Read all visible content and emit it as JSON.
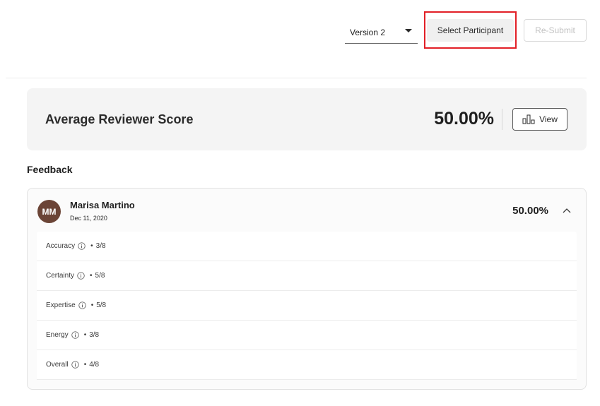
{
  "toolbar": {
    "version_value": "Version 2",
    "select_participant_label": "Select Participant",
    "resubmit_label": "Re-Submit"
  },
  "score_card": {
    "title": "Average Reviewer Score",
    "score": "50.00%",
    "view_label": "View"
  },
  "feedback": {
    "heading": "Feedback",
    "review": {
      "avatar_initials": "MM",
      "reviewer_name": "Marisa Martino",
      "date": "Dec 11, 2020",
      "score": "50.00%",
      "criteria": [
        {
          "label": "Accuracy",
          "bullet": "•",
          "value": "3/8"
        },
        {
          "label": "Certainty",
          "bullet": "•",
          "value": "5/8"
        },
        {
          "label": "Expertise",
          "bullet": "•",
          "value": "5/8"
        },
        {
          "label": "Energy",
          "bullet": "•",
          "value": "3/8"
        },
        {
          "label": "Overall",
          "bullet": "•",
          "value": "4/8"
        }
      ]
    }
  },
  "colors": {
    "highlight": "#e21f26",
    "avatar_bg": "#6b4436",
    "card_bg": "#f4f4f4"
  },
  "icons": {
    "dropdown": "caret-down-icon",
    "view": "bar-chart-icon",
    "collapse": "chevron-up-icon",
    "info": "info-icon"
  }
}
